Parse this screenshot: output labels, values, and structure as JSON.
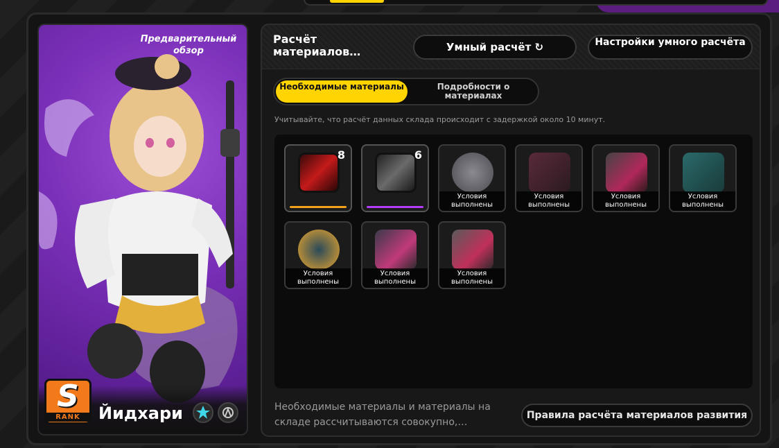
{
  "character": {
    "preview_label": "Предварительный обзор",
    "rank_letter": "S",
    "rank_word": "RANK",
    "name": "Йидхари"
  },
  "panel": {
    "title": "Расчёт материалов…",
    "smart_calc_label": "Умный расчёт",
    "smart_calc_icon": "refresh-icon",
    "smart_settings_label": "Настройки умного расчёта"
  },
  "tabs": [
    {
      "label": "Необходимые материалы",
      "active": true
    },
    {
      "label": "Подробности о материалах",
      "active": false
    }
  ],
  "notice": "Учитывайте, что расчёт данных склада происходит с задержкой около 10 минут.",
  "materials": [
    {
      "icon": "red-chip-icon",
      "count": "8",
      "status": "",
      "bar_color": "#f2a11a"
    },
    {
      "icon": "purple-chip-icon",
      "count": "6",
      "status": "",
      "bar_color": "#b43cff"
    },
    {
      "icon": "silver-coin-icon",
      "count": "",
      "status": "Условия выполнены"
    },
    {
      "icon": "music-box-icon",
      "count": "",
      "status": "Условия выполнены"
    },
    {
      "icon": "reel-device-icon",
      "count": "",
      "status": "Условия выполнены"
    },
    {
      "icon": "teal-star-box-icon",
      "count": "",
      "status": "Условия выполнены"
    },
    {
      "icon": "gold-ring-icon",
      "count": "",
      "status": "Условия выполнены"
    },
    {
      "icon": "note-crate-icon",
      "count": "",
      "status": "Условия выполнены"
    },
    {
      "icon": "pink-floppy-icon",
      "count": "",
      "status": "Условия выполнены"
    }
  ],
  "footer": {
    "description": "Необходимые материалы и материалы на складе рассчитываются совокупно,…",
    "rules_label": "Правила расчёта материалов развития"
  },
  "colors": {
    "accent": "#ffd400",
    "purple": "#7a2fb8",
    "rank": "#f27a1a"
  }
}
